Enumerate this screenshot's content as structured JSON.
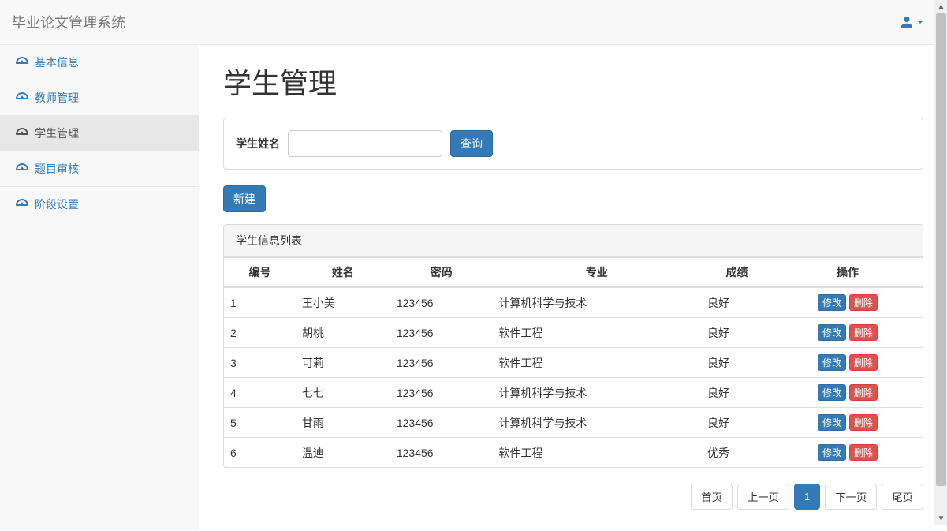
{
  "navbar": {
    "brand": "毕业论文管理系统"
  },
  "sidebar": {
    "items": [
      {
        "label": "基本信息"
      },
      {
        "label": "教师管理"
      },
      {
        "label": "学生管理"
      },
      {
        "label": "题目审核"
      },
      {
        "label": "阶段设置"
      }
    ]
  },
  "main": {
    "title": "学生管理",
    "search": {
      "label": "学生姓名",
      "button": "查询"
    },
    "newButton": "新建",
    "panel": {
      "heading": "学生信息列表"
    },
    "table": {
      "headers": [
        "编号",
        "姓名",
        "密码",
        "专业",
        "成绩",
        "操作"
      ],
      "rows": [
        {
          "id": "1",
          "name": "王小美",
          "password": "123456",
          "major": "计算机科学与技术",
          "grade": "良好"
        },
        {
          "id": "2",
          "name": "胡桃",
          "password": "123456",
          "major": "软件工程",
          "grade": "良好"
        },
        {
          "id": "3",
          "name": "可莉",
          "password": "123456",
          "major": "软件工程",
          "grade": "良好"
        },
        {
          "id": "4",
          "name": "七七",
          "password": "123456",
          "major": "计算机科学与技术",
          "grade": "良好"
        },
        {
          "id": "5",
          "name": "甘雨",
          "password": "123456",
          "major": "计算机科学与技术",
          "grade": "良好"
        },
        {
          "id": "6",
          "name": "温迪",
          "password": "123456",
          "major": "软件工程",
          "grade": "优秀"
        }
      ],
      "actions": {
        "edit": "修改",
        "delete": "删除"
      }
    },
    "pagination": {
      "first": "首页",
      "prev": "上一页",
      "current": "1",
      "next": "下一页",
      "last": "尾页"
    }
  }
}
